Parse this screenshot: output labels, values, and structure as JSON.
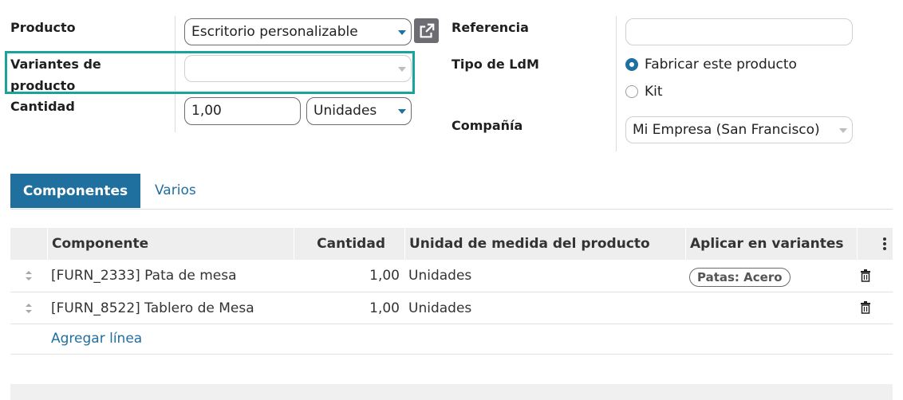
{
  "form": {
    "product_label": "Producto",
    "product_value": "Escritorio personalizable",
    "variants_label_line1": "Variantes de",
    "variants_label_line2": "producto",
    "variants_value": "",
    "quantity_label": "Cantidad",
    "quantity_value": "1,00",
    "uom_value": "Unidades",
    "reference_label": "Referencia",
    "reference_value": "",
    "bom_type_label": "Tipo de LdM",
    "bom_type_options": [
      {
        "label": "Fabricar este producto",
        "selected": true
      },
      {
        "label": "Kit",
        "selected": false
      }
    ],
    "company_label": "Compañía",
    "company_value": "Mi Empresa (San Francisco)"
  },
  "tabs": [
    {
      "label": "Componentes",
      "active": true
    },
    {
      "label": "Varios",
      "active": false
    }
  ],
  "table": {
    "headers": [
      "Componente",
      "Cantidad",
      "Unidad de medida del producto",
      "Aplicar en variantes"
    ],
    "rows": [
      {
        "component": "[FURN_2333] Pata de mesa",
        "quantity": "1,00",
        "uom": "Unidades",
        "variant_tag": "Patas: Acero"
      },
      {
        "component": "[FURN_8522] Tablero de Mesa",
        "quantity": "1,00",
        "uom": "Unidades",
        "variant_tag": ""
      }
    ],
    "add_line": "Agregar línea"
  },
  "colors": {
    "accent": "#1f6f9f",
    "highlight": "#1aa39a"
  },
  "icons": [
    "external-link-icon",
    "drag-handle-icon",
    "trash-icon",
    "options-kebab-icon"
  ]
}
